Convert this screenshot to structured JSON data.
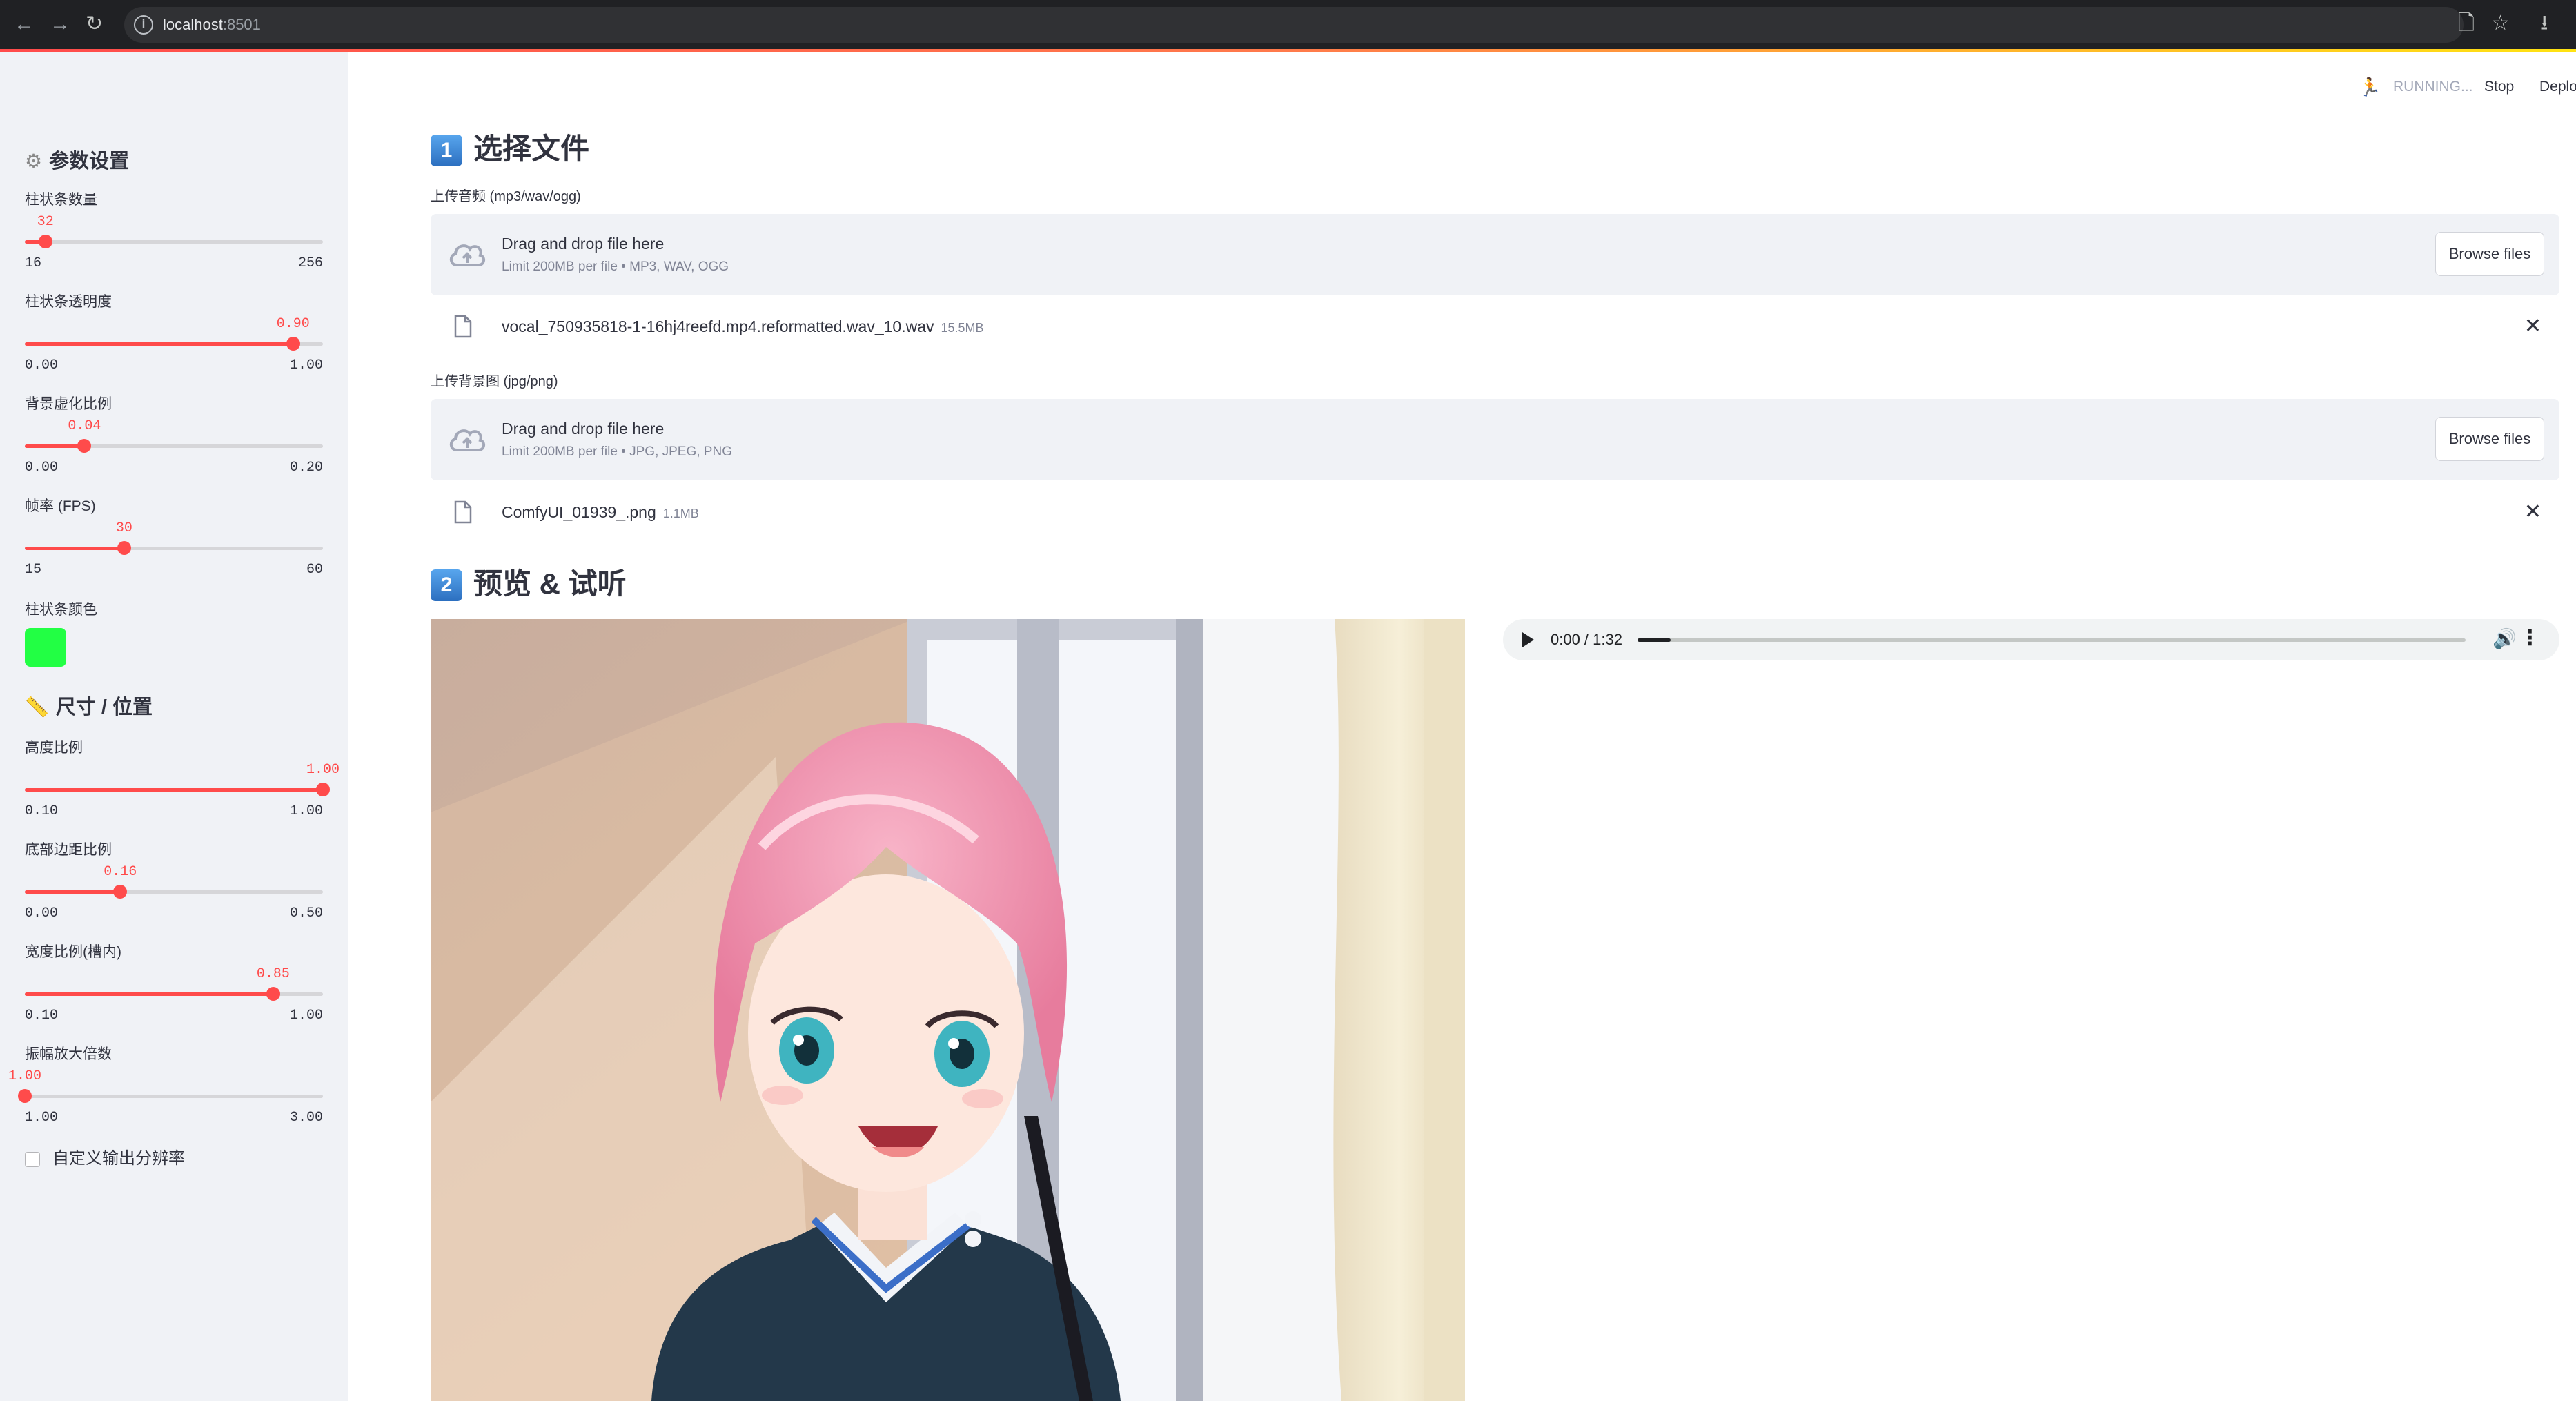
{
  "browser": {
    "back_icon": "←",
    "forward_icon": "→",
    "reload_icon": "↻",
    "info_icon": "i",
    "url_host": "localhost",
    "url_port": ":8501",
    "page_icon": "🗋",
    "star_icon": "☆",
    "download_icon": "⭳"
  },
  "toolbar": {
    "status": "RUNNING...",
    "stop_label": "Stop",
    "deploy_label": "Deplo"
  },
  "sidebar": {
    "section1_icon": "⚙",
    "section1_title": "参数设置",
    "sliders": [
      {
        "label": "柱状条数量",
        "value": "32",
        "min": "16",
        "max": "256",
        "fraction": 0.069
      },
      {
        "label": "柱状条透明度",
        "value": "0.90",
        "min": "0.00",
        "max": "1.00",
        "fraction": 0.9
      },
      {
        "label": "背景虚化比例",
        "value": "0.04",
        "min": "0.00",
        "max": "0.20",
        "fraction": 0.2
      },
      {
        "label": "帧率 (FPS)",
        "value": "30",
        "min": "15",
        "max": "60",
        "fraction": 0.333
      }
    ],
    "color_label": "柱状条颜色",
    "bar_color": "#22ff44",
    "section2_icon": "📏",
    "section2_title": "尺寸 / 位置",
    "sliders2": [
      {
        "label": "高度比例",
        "value": "1.00",
        "min": "0.10",
        "max": "1.00",
        "fraction": 1.0
      },
      {
        "label": "底部边距比例",
        "value": "0.16",
        "min": "0.00",
        "max": "0.50",
        "fraction": 0.32
      },
      {
        "label": "宽度比例(槽内)",
        "value": "0.85",
        "min": "0.10",
        "max": "1.00",
        "fraction": 0.833
      },
      {
        "label": "振幅放大倍数",
        "value": "1.00",
        "min": "1.00",
        "max": "3.00",
        "fraction": 0.0
      }
    ],
    "checkbox_label": "自定义输出分辨率"
  },
  "main": {
    "section1_num": "1",
    "section1_title": "选择文件",
    "audio_upload": {
      "label": "上传音频 (mp3/wav/ogg)",
      "drop_text": "Drag and drop file here",
      "limit_text": "Limit 200MB per file • MP3, WAV, OGG",
      "browse_label": "Browse files",
      "file_name": "vocal_750935818-1-16hj4reefd.mp4.reformatted.wav_10.wav",
      "file_size": "15.5MB"
    },
    "image_upload": {
      "label": "上传背景图 (jpg/png)",
      "drop_text": "Drag and drop file here",
      "limit_text": "Limit 200MB per file • JPG, JPEG, PNG",
      "browse_label": "Browse files",
      "file_name": "ComfyUI_01939_.png",
      "file_size": "1.1MB"
    },
    "section2_num": "2",
    "section2_title": "预览 & 试听",
    "audio_player": {
      "time": "0:00 / 1:32",
      "progress": 0.04
    }
  }
}
